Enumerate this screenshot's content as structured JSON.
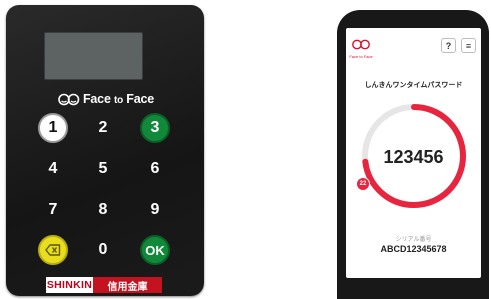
{
  "token": {
    "brand": {
      "pre": "Face ",
      "mid": "to",
      "post": " Face"
    },
    "keys": {
      "k1": "1",
      "k2": "2",
      "k3": "3",
      "k4": "4",
      "k5": "5",
      "k6": "6",
      "k7": "7",
      "k8": "8",
      "k9": "9",
      "k0": "0",
      "ok": "OK"
    },
    "badge": {
      "left": "SHINKIN",
      "right": "信用金庫"
    }
  },
  "app": {
    "logo_text": "Face to Face",
    "help_label": "?",
    "menu_label": "≡",
    "title": "しんきんワンタイムパスワード",
    "otp": "123456",
    "timer_seconds": "22",
    "timer_progress": 0.73,
    "serial_label": "シリアル番号",
    "serial_number": "ABCD12345678"
  },
  "colors": {
    "accent_red": "#e8253f",
    "key_green": "#12893a",
    "key_yellow": "#e8de1e"
  }
}
